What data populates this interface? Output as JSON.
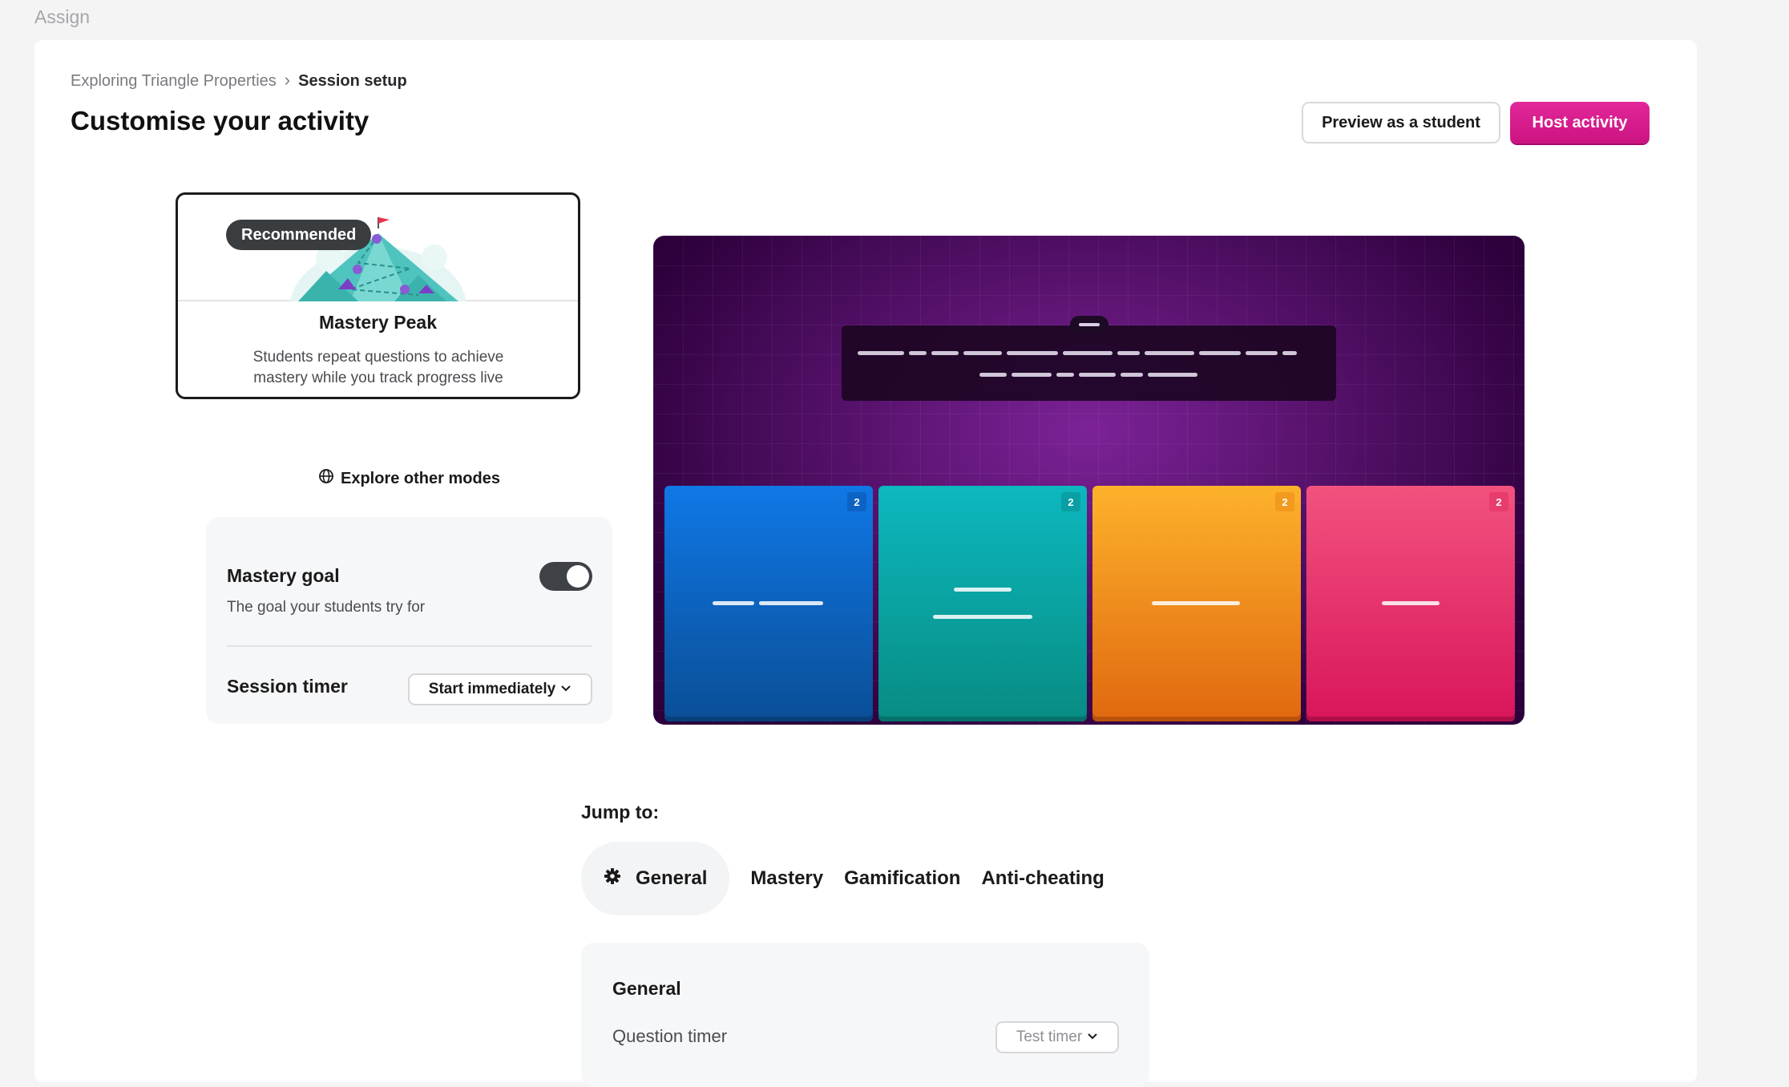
{
  "top_label": "Assign",
  "breadcrumb": {
    "parent": "Exploring Triangle Properties",
    "current": "Session setup"
  },
  "page_title": "Customise your activity",
  "header_buttons": {
    "preview": "Preview as a student",
    "host": "Host activity"
  },
  "mode": {
    "badge": "Recommended",
    "name": "Mastery Peak",
    "description": "Students repeat questions to achieve mastery while you track progress live",
    "explore": "Explore other modes"
  },
  "settings": {
    "mastery_goal": {
      "title": "Mastery goal",
      "description": "The goal your students try for",
      "enabled": true
    },
    "session_timer": {
      "title": "Session timer",
      "value": "Start immediately"
    }
  },
  "preview": {
    "answers": [
      {
        "count": "2",
        "color": "#0f78e6"
      },
      {
        "count": "2",
        "color": "#0cb8bf"
      },
      {
        "count": "2",
        "color": "#fdb22b"
      },
      {
        "count": "2",
        "color": "#f2527e"
      }
    ]
  },
  "jump": {
    "label": "Jump to:",
    "tabs": [
      "General",
      "Mastery",
      "Gamification",
      "Anti-cheating"
    ]
  },
  "general_panel": {
    "title": "General",
    "question_timer_label": "Question timer",
    "question_timer_value": "Test timer"
  },
  "colors": {
    "accent": "#d81b8c",
    "preview_bg": "#5a0a70"
  }
}
